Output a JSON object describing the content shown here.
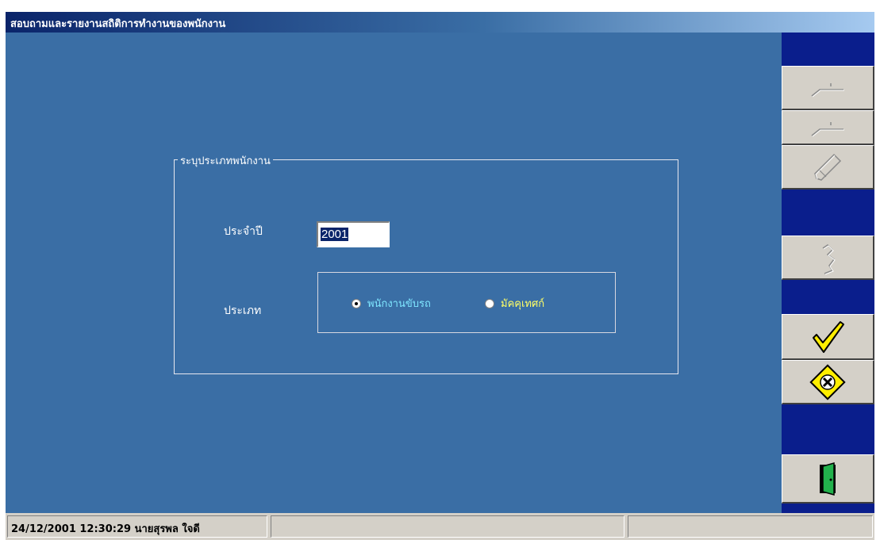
{
  "window": {
    "title": "สอบถามและรายงานสถิติการทำงานของพนักงาน"
  },
  "form": {
    "group_label": "ระบุประเภทพนักงาน",
    "year_label": "ประจำปี",
    "year_value": "2001",
    "type_label": "ประเภท",
    "type_options": [
      {
        "label": "พนักงานขับรถ",
        "selected": true,
        "color": "#7fe6ff"
      },
      {
        "label": "มัคคุเทศก์",
        "selected": false,
        "color": "#ffff66"
      }
    ]
  },
  "toolbar": {
    "buttons": [
      {
        "name": "add-icon",
        "enabled": false
      },
      {
        "name": "insert-icon",
        "enabled": false
      },
      {
        "name": "edit-pencil-icon",
        "enabled": false
      },
      {
        "name": "delete-icon",
        "enabled": false
      },
      {
        "name": "ok-checkmark-icon",
        "enabled": true
      },
      {
        "name": "cancel-icon",
        "enabled": true
      },
      {
        "name": "exit-door-icon",
        "enabled": true
      }
    ]
  },
  "status": {
    "datetime_user": "24/12/2001 12:30:29 นายสุรพล ใจดี",
    "panel2": "",
    "panel3": ""
  },
  "colors": {
    "client_bg": "#3a6ea5",
    "toolbar_bg": "#0a1e8c",
    "selection": "#0a246a",
    "check": "#ffee00",
    "cancel": "#ffee00"
  }
}
